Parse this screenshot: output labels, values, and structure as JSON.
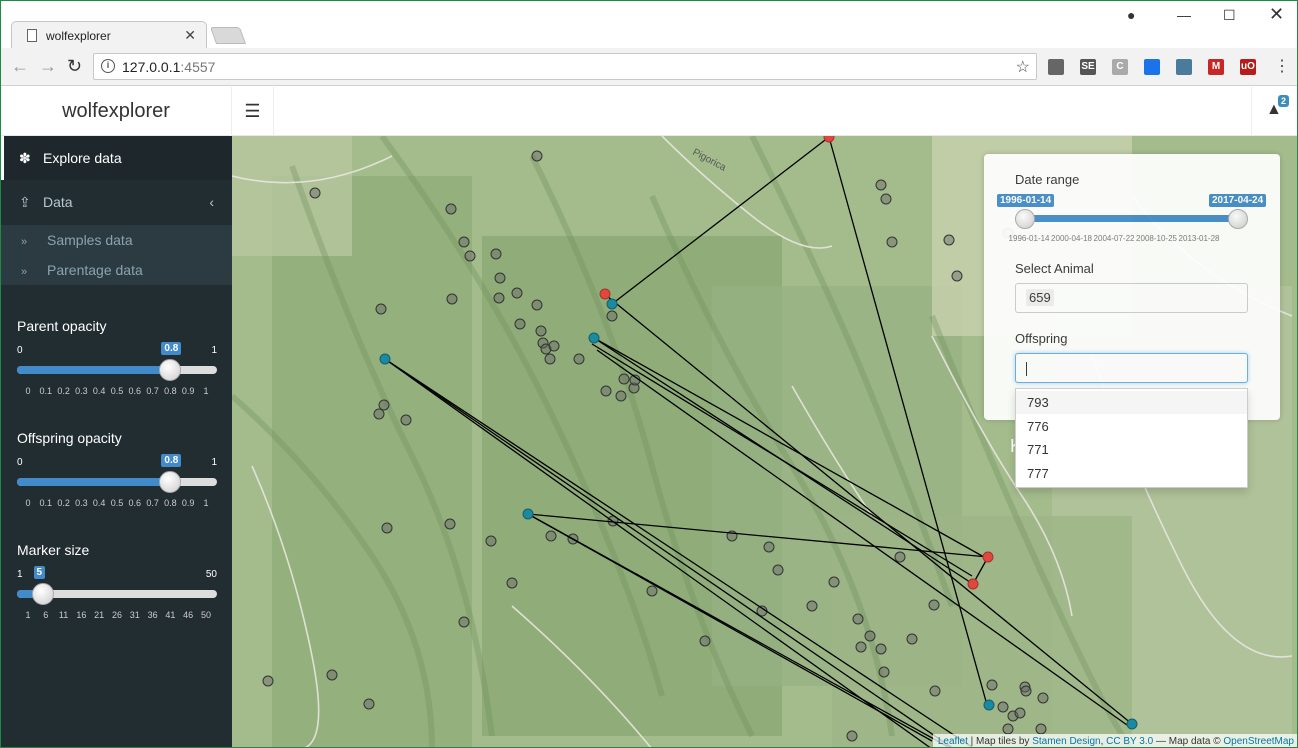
{
  "browser": {
    "tab_title": "wolfexplorer",
    "url_host": "127.0.0.1",
    "url_port": ":4557",
    "extensions": [
      {
        "name": "layers-ext-icon",
        "label": "",
        "color": "#666"
      },
      {
        "name": "se-ext-icon",
        "label": "SE",
        "color": "#555"
      },
      {
        "name": "c-ext-icon",
        "label": "C",
        "color": "#aaa"
      },
      {
        "name": "diamond-ext-icon",
        "label": "",
        "color": "#1a73e8"
      },
      {
        "name": "satellite-ext-icon",
        "label": "",
        "color": "#4a7a9c"
      },
      {
        "name": "m-ext-icon",
        "label": "M",
        "color": "#c62828"
      },
      {
        "name": "ublock-ext-icon",
        "label": "uO",
        "color": "#b71c1c"
      }
    ]
  },
  "header": {
    "brand": "wolfexplorer",
    "notif_count": "2"
  },
  "sidebar": {
    "explore": "Explore data",
    "data": "Data",
    "samples": "Samples data",
    "parentage": "Parentage data"
  },
  "sliders": {
    "parent": {
      "label": "Parent opacity",
      "min": "0",
      "max": "1",
      "value": "0.8",
      "fraction": 0.8,
      "ticks": [
        "0",
        "0.1",
        "0.2",
        "0.3",
        "0.4",
        "0.5",
        "0.6",
        "0.7",
        "0.8",
        "0.9",
        "1"
      ]
    },
    "offspring": {
      "label": "Offspring opacity",
      "min": "0",
      "max": "1",
      "value": "0.8",
      "fraction": 0.8,
      "ticks": [
        "0",
        "0.1",
        "0.2",
        "0.3",
        "0.4",
        "0.5",
        "0.6",
        "0.7",
        "0.8",
        "0.9",
        "1"
      ]
    },
    "marker": {
      "label": "Marker size",
      "min": "1",
      "max": "50",
      "value": "5",
      "fraction": 0.0816,
      "ticks": [
        "1",
        "6",
        "11",
        "16",
        "21",
        "26",
        "31",
        "36",
        "41",
        "46",
        "50"
      ]
    }
  },
  "panel": {
    "date_label": "Date range",
    "date_from": "1996-01-14",
    "date_to": "2017-04-24",
    "date_ticks": [
      "1996-01-14",
      "2000-04-18",
      "2004-07-22",
      "2008-10-25",
      "2013-01-28"
    ],
    "animal_label": "Select Animal",
    "animal_value": "659",
    "offspring_label": "Offspring",
    "offspring_options": [
      "793",
      "776",
      "771",
      "777"
    ]
  },
  "map": {
    "place_label": "Pigorica",
    "label_k": "K",
    "label_e": "e",
    "colors": {
      "parent": "#e0483f",
      "offspring": "#1a8aa0",
      "sample": "#555"
    }
  },
  "attribution": {
    "leaflet": "Leaflet",
    "sep1": " | Map tiles by ",
    "stamen": "Stamen Design",
    "sep2": ", ",
    "ccby": "CC BY 3.0",
    "sep3": " — Map data © ",
    "osm": "OpenStreetMap"
  }
}
